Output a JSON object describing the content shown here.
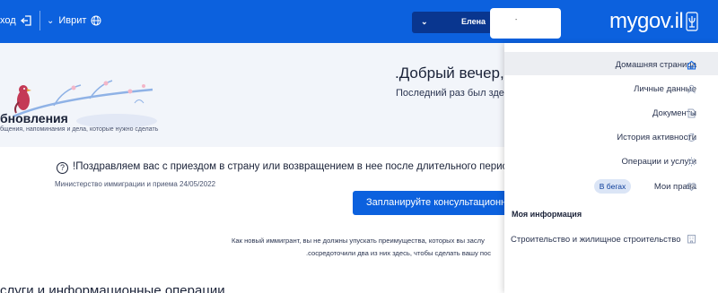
{
  "header": {
    "exit_label": "ход",
    "exit_icon": "logout-icon",
    "language_label": "Иврит",
    "language_icon": "globe-icon",
    "user_name": "Елена",
    "user_redacted_mark": "-",
    "logo_text": "mygov.il",
    "logo_icon": "menorah-seal-icon",
    "colors": {
      "primary": "#0c61de",
      "user_button": "#09368f"
    }
  },
  "welcome": {
    "greeting": ".Добрый вечер, ,",
    "last_login": "Последний раз был здесь"
  },
  "updates": {
    "title": "бновления",
    "subtitle": "бщения, напоминания и дела, которые нужно сделать"
  },
  "notice": {
    "icon": "question-circle-icon",
    "text": "!Поздравляем вас с приездом в страну или возвращением в нее после длительного периода време",
    "ministry_line": "Министерство иммиграции и приема 24/05/2022",
    "button_label": "Запланируйте консультационную в"
  },
  "immigrant_text": {
    "line1": "Как новый иммигрант, вы не должны упускать преимущества, которых вы заслу",
    "line2": ".сосредоточили два из них здесь, чтобы сделать вашу пос"
  },
  "services": {
    "title": "слуги и информационные операции"
  },
  "sidebar": {
    "items": [
      {
        "label": "Домашняя страница",
        "icon": "home-icon"
      },
      {
        "label": "Личные данные",
        "icon": "person-icon"
      },
      {
        "label": "Документы",
        "icon": "document-icon"
      },
      {
        "label": "История активности",
        "icon": "history-icon"
      },
      {
        "label": "Операции и услуги",
        "icon": "services-icon"
      },
      {
        "label": "Мои права",
        "icon": "heart-icon",
        "badge": "В бегах"
      }
    ],
    "section_title": "Моя информация",
    "section_items": [
      {
        "label": "Строительство и жилищное строительство",
        "icon": "building-icon"
      }
    ]
  }
}
